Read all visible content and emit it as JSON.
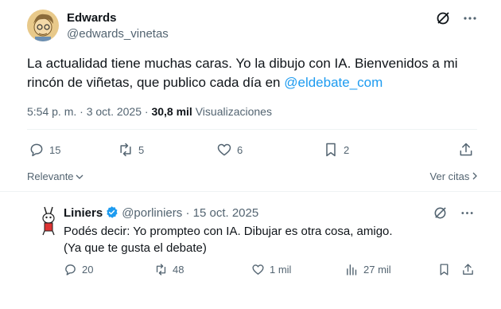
{
  "tweet": {
    "author_name": "Edwards",
    "author_handle": "@edwards_vinetas",
    "text_before_mention": "La actualidad tiene muchas caras. Yo la dibujo con IA. Bienvenidos a mi rincón de viñetas, que publico cada día en ",
    "mention": "@eldebate_com",
    "time": "5:54 p. m.",
    "separator": " · ",
    "date": "3 oct. 2025",
    "views_count": "30,8 mil",
    "views_label": "Visualizaciones",
    "replies": "15",
    "reposts": "5",
    "likes": "6",
    "bookmarks": "2"
  },
  "sort": {
    "left_label": "Relevante",
    "right_label": "Ver citas"
  },
  "reply": {
    "author_name": "Liniers",
    "author_handle": "@porliniers",
    "separator": " · ",
    "date": "15 oct. 2025",
    "line1": "Podés decir: Yo prompteo con IA. Dibujar es otra cosa, amigo.",
    "line2": "(Ya que te gusta el debate)",
    "replies": "20",
    "reposts": "48",
    "likes": "1 mil",
    "views": "27 mil"
  },
  "colors": {
    "accent": "#1d9bf0",
    "secondary_text": "#536471",
    "primary_text": "#0f1419"
  },
  "icons": [
    "grok-icon",
    "more-icon",
    "reply-icon",
    "repost-icon",
    "like-icon",
    "bookmark-icon",
    "share-icon",
    "views-icon",
    "verified-icon"
  ]
}
